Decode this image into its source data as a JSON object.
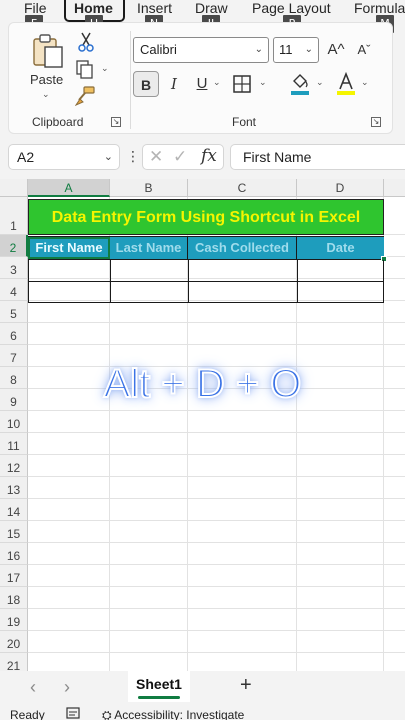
{
  "ribbon_tabs": [
    {
      "label": "File",
      "keytip": "F"
    },
    {
      "label": "Home",
      "keytip": "H",
      "active": true
    },
    {
      "label": "Insert",
      "keytip": "N"
    },
    {
      "label": "Draw",
      "keytip": "JI"
    },
    {
      "label": "Page Layout",
      "keytip": "P"
    },
    {
      "label": "Formula",
      "keytip": "M"
    }
  ],
  "clipboard": {
    "paste_label": "Paste",
    "group_label": "Clipboard"
  },
  "font": {
    "name": "Calibri",
    "size": "11",
    "group_label": "Font",
    "grow_icon": "A^",
    "shrink_icon": "Aˇ",
    "bold_label": "B",
    "italic_label": "I",
    "underline_label": "U",
    "fill_color": "#1e9dbd",
    "font_color": "#f5f500"
  },
  "formula_bar": {
    "name_box": "A2",
    "fx_label": "fx",
    "formula": "First Name"
  },
  "columns": [
    "A",
    "B",
    "C",
    "D"
  ],
  "rows": [
    "1",
    "2",
    "3",
    "4",
    "5",
    "6",
    "7",
    "8",
    "9",
    "10",
    "11",
    "12",
    "13",
    "14",
    "15",
    "16",
    "17",
    "18",
    "19",
    "20",
    "21"
  ],
  "sheet": {
    "title": "Data Entry Form Using Shortcut in Excel",
    "headers": [
      "First Name",
      "Last Name",
      "Cash Collected",
      "Date"
    ],
    "title_bg": "#2fc52f",
    "title_color": "#f5f500",
    "header_bg": "#1e9dbd"
  },
  "overlay": {
    "text": "Alt + D + O",
    "color": "#3b73e6"
  },
  "sheet_tabs": {
    "active": "Sheet1",
    "add_label": "+"
  },
  "status_bar": {
    "ready": "Ready",
    "accessibility": "Accessibility: Investigate"
  }
}
